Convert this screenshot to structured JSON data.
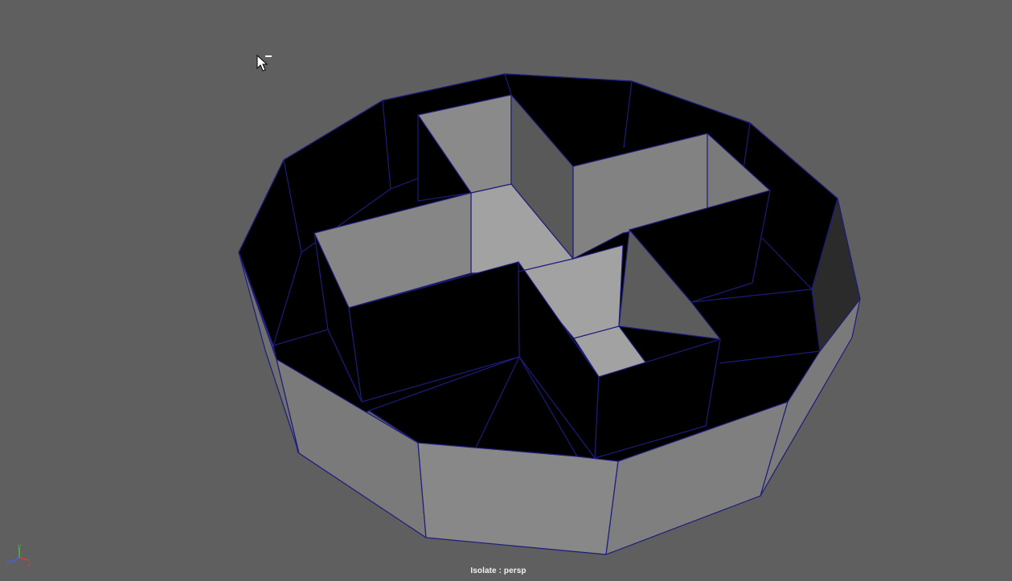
{
  "viewport": {
    "camera_label": "Isolate : persp",
    "background_color": "#5f5f5f"
  },
  "axis_gizmo": {
    "x_label": "x",
    "y_label": "y",
    "z_label": "z",
    "x_color": "#d04040",
    "y_color": "#40c040",
    "z_color": "#4060ff"
  },
  "cursor": {
    "icon": "arrow-cursor-icon"
  },
  "model": {
    "wire_color": "#1a1a7a",
    "inner_color": "#000000",
    "outer_wall_color": "#848484",
    "floor_color": "#a3a3a3"
  }
}
